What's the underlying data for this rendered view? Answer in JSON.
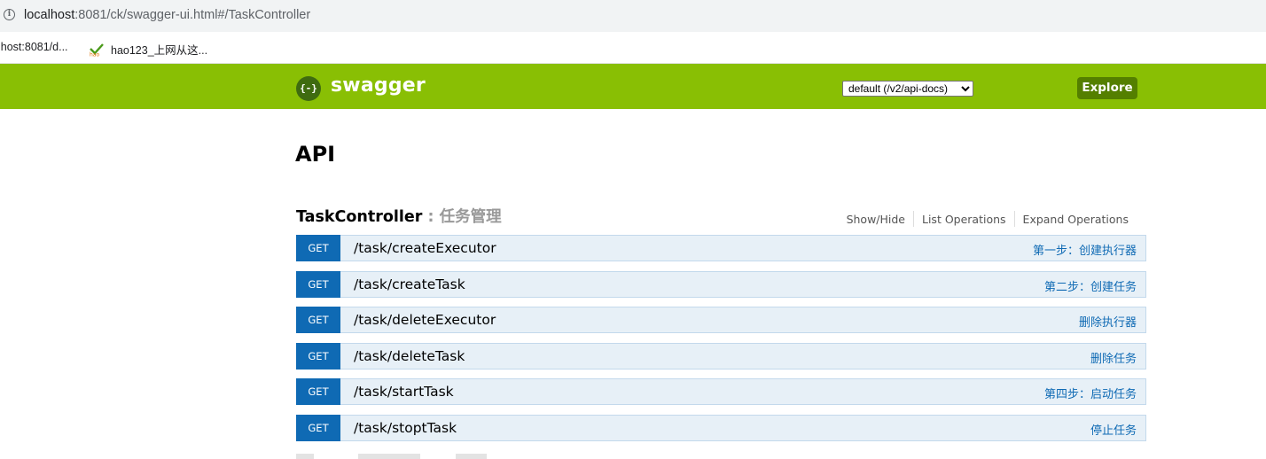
{
  "browser": {
    "url_host": "localhost",
    "url_path": ":8081/ck/swagger-ui.html#/TaskController",
    "bookmarks": [
      {
        "label": "lhost:8081/d..."
      },
      {
        "label": "hao123_上网从这..."
      }
    ]
  },
  "header": {
    "logo_glyph": "{-}",
    "brand": "swagger",
    "spec_select_value": "default (/v2/api-docs)",
    "explore_label": "Explore",
    "bg_color": "#89bf04"
  },
  "main": {
    "title": "API",
    "resource": {
      "name": "TaskController",
      "description": " : 任务管理",
      "options": [
        "Show/Hide",
        "List Operations",
        "Expand Operations"
      ],
      "operations": [
        {
          "method": "GET",
          "path": "/task/createExecutor",
          "summary": "第一步：创建执行器"
        },
        {
          "method": "GET",
          "path": "/task/createTask",
          "summary": "第二步：创建任务"
        },
        {
          "method": "GET",
          "path": "/task/deleteExecutor",
          "summary": "删除执行器"
        },
        {
          "method": "GET",
          "path": "/task/deleteTask",
          "summary": "删除任务"
        },
        {
          "method": "GET",
          "path": "/task/startTask",
          "summary": "第四步：启动任务"
        },
        {
          "method": "GET",
          "path": "/task/stoptTask",
          "summary": "停止任务"
        }
      ]
    }
  },
  "colors": {
    "get_method": "#0f6ab4",
    "get_row_bg": "#e7f0f7",
    "explore_button": "#547f00"
  }
}
